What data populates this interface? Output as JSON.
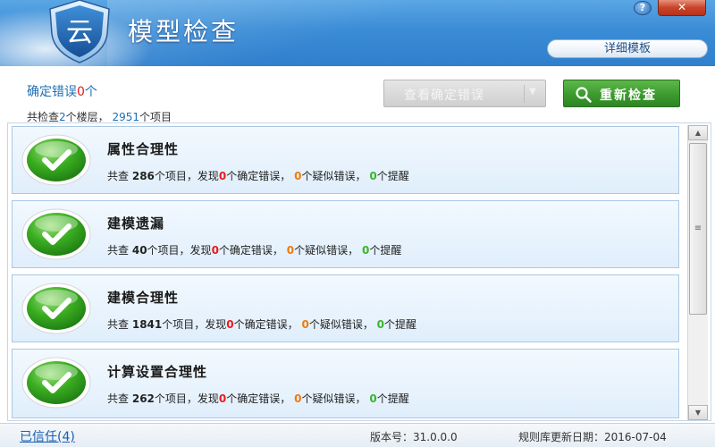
{
  "window": {
    "title": "模型检查",
    "logo_char": "云",
    "help_label": "?",
    "close_label": "✕",
    "detail_template_label": "详细模板"
  },
  "summary": {
    "definite_errors_prefix": "确定错误",
    "definite_errors_count": "0",
    "definite_errors_suffix": "个",
    "scope_prefix": "共检查",
    "floors": "2",
    "floors_suffix": "个楼层，",
    "items": "2951",
    "items_suffix": "个项目"
  },
  "toolbar": {
    "view_errors_label": "查看确定错误",
    "recheck_label": "重新检查"
  },
  "checks": [
    {
      "title": "属性合理性",
      "total": "286",
      "definite": "0",
      "suspect": "0",
      "reminder": "0"
    },
    {
      "title": "建模遗漏",
      "total": "40",
      "definite": "0",
      "suspect": "0",
      "reminder": "0"
    },
    {
      "title": "建模合理性",
      "total": "1841",
      "definite": "0",
      "suspect": "0",
      "reminder": "0"
    },
    {
      "title": "计算设置合理性",
      "total": "262",
      "definite": "0",
      "suspect": "0",
      "reminder": "0"
    }
  ],
  "stat_text": {
    "prefix": "共查",
    "items_found": "个项目，发现",
    "definite": "个确定错误，",
    "suspect": "个疑似错误，",
    "reminder": "个提醒"
  },
  "footer": {
    "trusted_label": "已信任(4)",
    "version_label": "版本号：31.0.0.0",
    "rule_date_label": "规则库更新日期：2016-07-04"
  },
  "colors": {
    "header_blue": "#3b8cd6",
    "accent_blue": "#1f6fb3",
    "error_red": "#e81c1c",
    "suspect_orange": "#f07a0c",
    "reminder_green": "#3bb52b",
    "recheck_green": "#3c9a2e"
  },
  "icons": {
    "logo": "shield-icon",
    "check": "check-circle-icon",
    "recheck": "magnifier-icon",
    "dropdown": "caret-down-icon"
  }
}
